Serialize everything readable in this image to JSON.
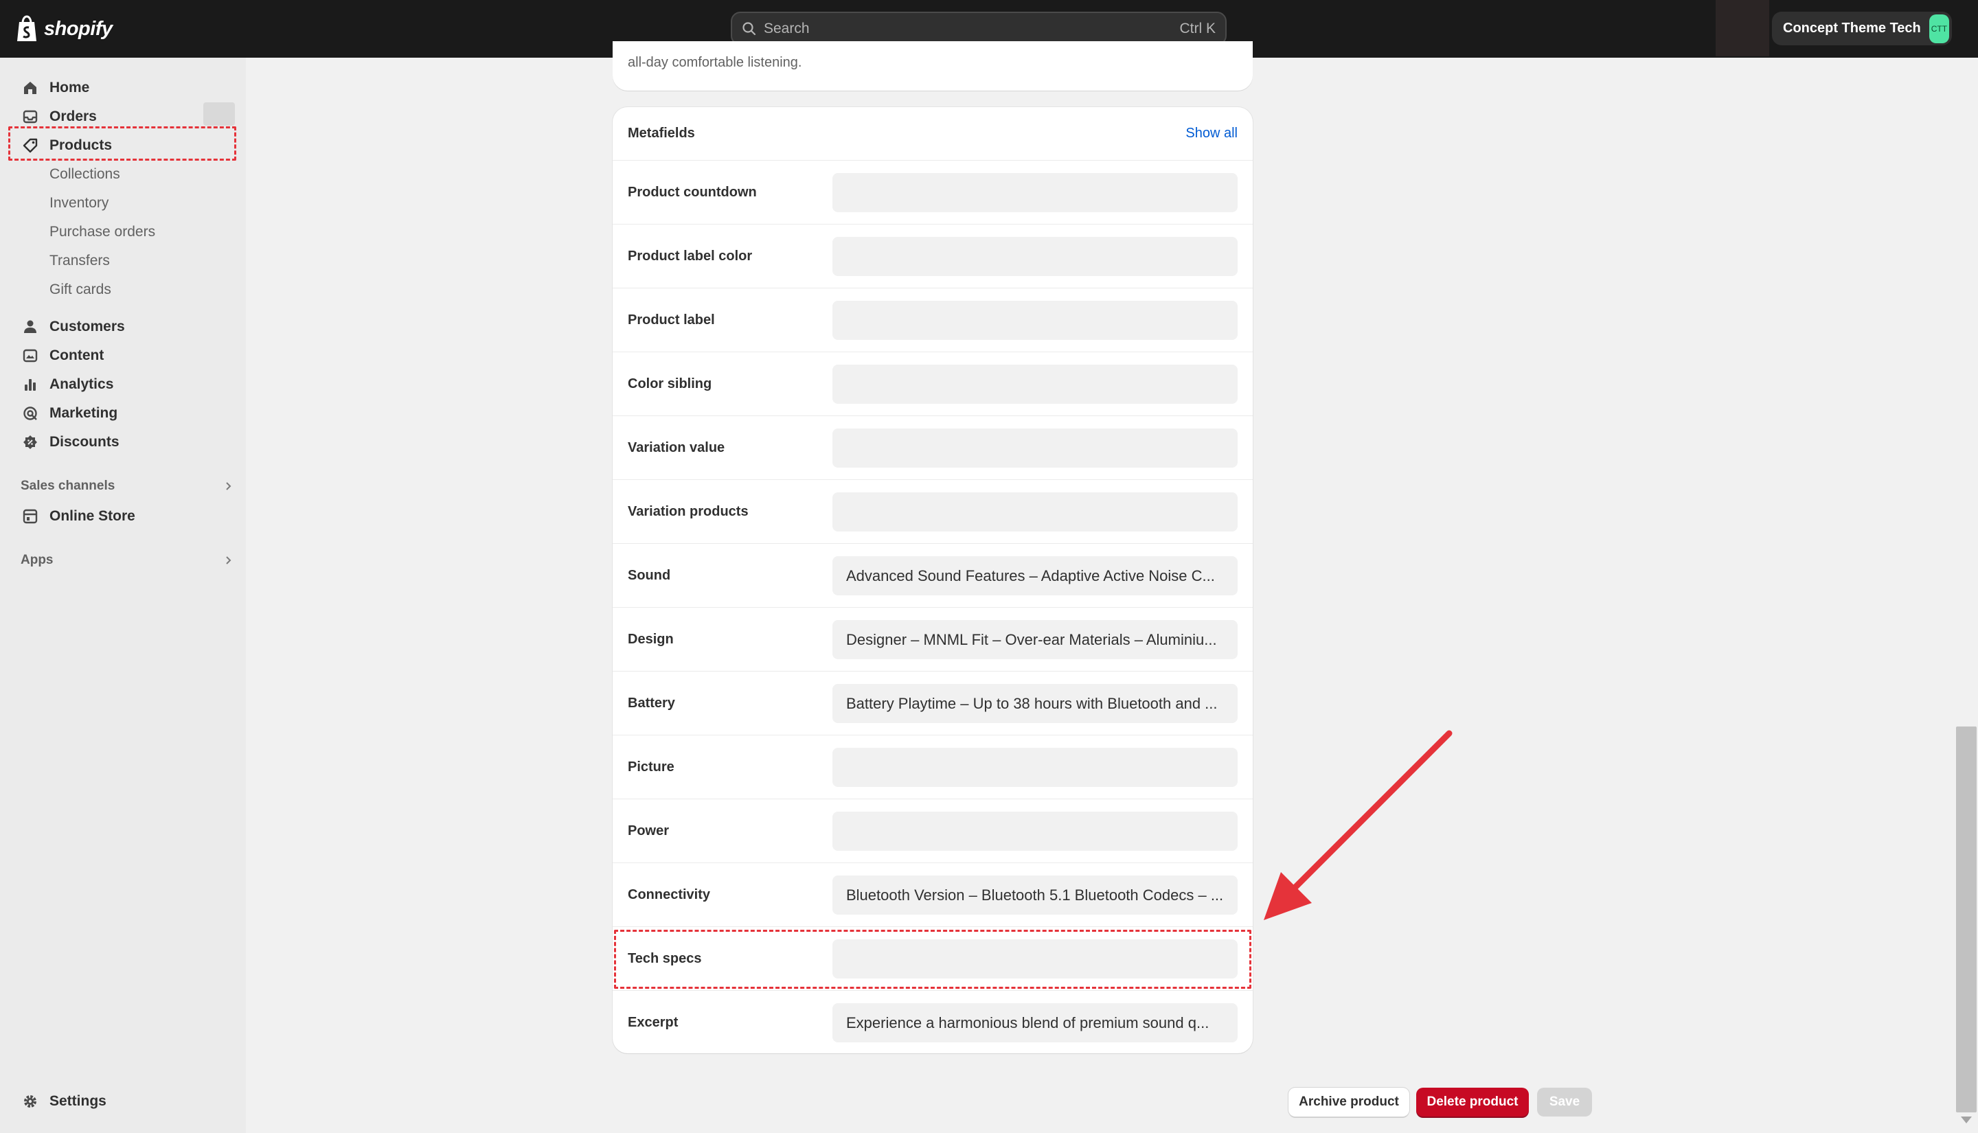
{
  "topbar": {
    "brand": "shopify",
    "search_placeholder": "Search",
    "search_shortcut": "Ctrl K",
    "store_name": "Concept Theme Tech",
    "store_initials": "CTT",
    "avatar_color": "#4fe3a3"
  },
  "sidebar": {
    "items": [
      {
        "label": "Home",
        "icon": "home-icon"
      },
      {
        "label": "Orders",
        "icon": "inbox-icon"
      },
      {
        "label": "Products",
        "icon": "tag-icon"
      }
    ],
    "products_sub": [
      "Collections",
      "Inventory",
      "Purchase orders",
      "Transfers",
      "Gift cards"
    ],
    "items2": [
      {
        "label": "Customers",
        "icon": "person-icon"
      },
      {
        "label": "Content",
        "icon": "content-icon"
      },
      {
        "label": "Analytics",
        "icon": "bar-chart-icon"
      },
      {
        "label": "Marketing",
        "icon": "target-icon"
      },
      {
        "label": "Discounts",
        "icon": "discount-icon"
      }
    ],
    "sales_channels_label": "Sales channels",
    "online_store_label": "Online Store",
    "apps_label": "Apps",
    "settings_label": "Settings"
  },
  "main": {
    "description_tail": "all-day comfortable listening.",
    "metafields": {
      "title": "Metafields",
      "show_all": "Show all",
      "rows": [
        {
          "label": "Product countdown",
          "value": ""
        },
        {
          "label": "Product label color",
          "value": ""
        },
        {
          "label": "Product label",
          "value": ""
        },
        {
          "label": "Color sibling",
          "value": ""
        },
        {
          "label": "Variation value",
          "value": ""
        },
        {
          "label": "Variation products",
          "value": ""
        },
        {
          "label": "Sound",
          "value": "Advanced Sound Features – Adaptive Active Noise C..."
        },
        {
          "label": "Design",
          "value": "Designer – MNML Fit – Over-ear Materials – Aluminiu..."
        },
        {
          "label": "Battery",
          "value": "Battery Playtime – Up to 38 hours with Bluetooth and ..."
        },
        {
          "label": "Picture",
          "value": ""
        },
        {
          "label": "Power",
          "value": ""
        },
        {
          "label": "Connectivity",
          "value": "Bluetooth Version – Bluetooth 5.1 Bluetooth Codecs – ..."
        },
        {
          "label": "Tech specs",
          "value": ""
        },
        {
          "label": "Excerpt",
          "value": "Experience a harmonious blend of premium sound q..."
        }
      ]
    }
  },
  "footer": {
    "archive_label": "Archive product",
    "delete_label": "Delete product",
    "save_label": "Save",
    "delete_color": "#c70a24"
  },
  "annotation": {
    "highlight_color": "#e5333a"
  }
}
